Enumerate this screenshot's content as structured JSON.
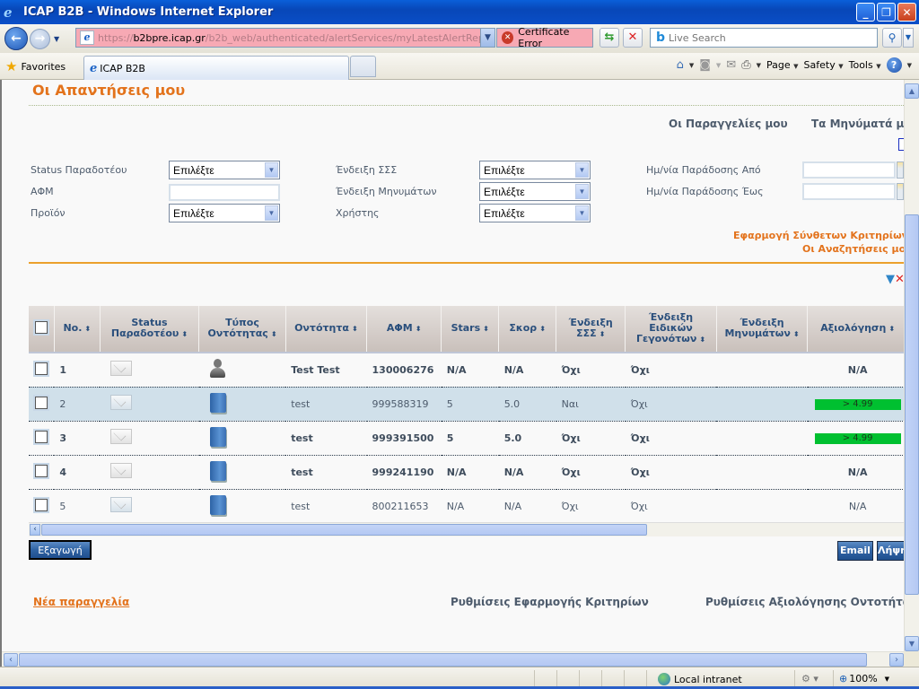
{
  "window": {
    "title": "ICAP B2B - Windows Internet Explorer",
    "controls": [
      "minimize",
      "restore",
      "close"
    ]
  },
  "navbar": {
    "url_prefix": "https://",
    "url_host": "b2bpre.icap.gr",
    "url_path": "/b2b_web/authenticated/alertServices/myLatestAlertReplies.seam",
    "cert_error": "Certificate Error",
    "search_placeholder": "Live Search"
  },
  "favbar": {
    "favorites_label": "Favorites",
    "tab_title": "ICAP B2B",
    "commands": {
      "page": "Page",
      "safety": "Safety",
      "tools": "Tools"
    }
  },
  "page": {
    "title": "Οι Απαντήσεις μου",
    "top_links": [
      "Οι Παραγγελίες μου",
      "Τα Μηνύματά μου"
    ],
    "filters": {
      "status_label": "Status Παραδοτέου",
      "status_value": "Επιλέξτε",
      "afm_label": "ΑΦΜ",
      "afm_value": "",
      "product_label": "Προϊόν",
      "product_value": "Επιλέξτε",
      "sss_label": "Ένδειξη ΣΣΣ",
      "sss_value": "Επιλέξτε",
      "messages_label": "Ένδειξη Μηνυμάτων",
      "messages_value": "Επιλέξτε",
      "user_label": "Χρήστης",
      "user_value": "Επιλέξτε",
      "date_from_label": "Ημ/νία Παράδοσης Από",
      "date_from_value": "",
      "date_to_label": "Ημ/νία Παράδοσης Έως",
      "date_to_value": ""
    },
    "apply_criteria_link": "Εφαρμογή Σύνθετων Κριτηρίων",
    "my_searches_link": "Οι Αναζητήσεις μου",
    "table": {
      "columns": [
        "No.",
        "Status Παραδοτέου",
        "Τύπος Οντότητας",
        "Οντότητα",
        "ΑΦΜ",
        "Stars",
        "Σκορ",
        "Ένδειξη ΣΣΣ",
        "Ένδειξη Ειδικών Γεγονότων",
        "Ένδειξη Μηνυμάτων",
        "Αξιολόγηση"
      ],
      "rows": [
        {
          "no": "1",
          "status_icon": "envelope-closed",
          "type_icon": "person",
          "entity": "Test Test",
          "afm": "130006276",
          "stars": "N/A",
          "score": "N/A",
          "sss": "Όχι",
          "special": "Όχι",
          "messages": "",
          "rating": "N/A",
          "rating_badge": false,
          "unread": true,
          "selected": false
        },
        {
          "no": "2",
          "status_icon": "envelope-open",
          "type_icon": "building",
          "entity": "test",
          "afm": "999588319",
          "stars": "5",
          "score": "5.0",
          "sss": "Ναι",
          "special": "Όχι",
          "messages": "",
          "rating": "> 4.99",
          "rating_badge": true,
          "unread": false,
          "selected": true
        },
        {
          "no": "3",
          "status_icon": "envelope-closed",
          "type_icon": "building",
          "entity": "test",
          "afm": "999391500",
          "stars": "5",
          "score": "5.0",
          "sss": "Όχι",
          "special": "Όχι",
          "messages": "",
          "rating": "> 4.99",
          "rating_badge": true,
          "unread": true,
          "selected": false
        },
        {
          "no": "4",
          "status_icon": "envelope-closed",
          "type_icon": "building",
          "entity": "test",
          "afm": "999241190",
          "stars": "N/A",
          "score": "N/A",
          "sss": "Όχι",
          "special": "Όχι",
          "messages": "",
          "rating": "N/A",
          "rating_badge": false,
          "unread": true,
          "selected": false
        },
        {
          "no": "5",
          "status_icon": "envelope-open",
          "type_icon": "building",
          "entity": "test",
          "afm": "800211653",
          "stars": "N/A",
          "score": "N/A",
          "sss": "Όχι",
          "special": "Όχι",
          "messages": "",
          "rating": "N/A",
          "rating_badge": false,
          "unread": false,
          "selected": false
        }
      ]
    },
    "buttons": {
      "export": "Εξαγωγή",
      "email": "Email",
      "download": "Λήψη"
    },
    "bottom_links": {
      "new_order": "Νέα παραγγελία",
      "criteria_settings": "Ρυθμίσεις Εφαρμογής Κριτηρίων",
      "entity_rating_settings": "Ρυθμίσεις Αξιολόγησης Οντοτήτων"
    },
    "colors": {
      "accent_orange": "#e3731c",
      "rating_green": "#00c030",
      "header_text": "#2a4f7c"
    }
  },
  "statusbar": {
    "zone": "Local intranet",
    "zoom": "100%"
  }
}
